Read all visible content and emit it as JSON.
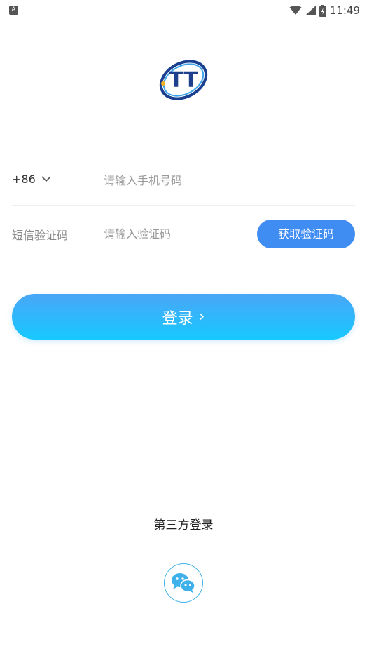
{
  "status_bar": {
    "app_badge": "A",
    "time": "11:49"
  },
  "logo": {
    "text": "TT"
  },
  "phone_row": {
    "country_code": "+86",
    "phone_placeholder": "请输入手机号码"
  },
  "code_row": {
    "label": "短信验证码",
    "code_placeholder": "请输入验证码",
    "get_code_label": "获取验证码"
  },
  "login": {
    "label": "登录",
    "chevron": "›"
  },
  "third_party": {
    "label": "第三方登录"
  },
  "colors": {
    "primary": "#3f8cf2",
    "gradient_top": "#4aa6f7",
    "gradient_bottom": "#17c8ff",
    "wechat": "#3fb1ea"
  },
  "icons": {
    "wifi": "wifi-icon",
    "cell": "cell-signal-icon",
    "battery": "battery-icon",
    "dropdown": "chevron-down-icon",
    "wechat": "wechat-icon"
  }
}
